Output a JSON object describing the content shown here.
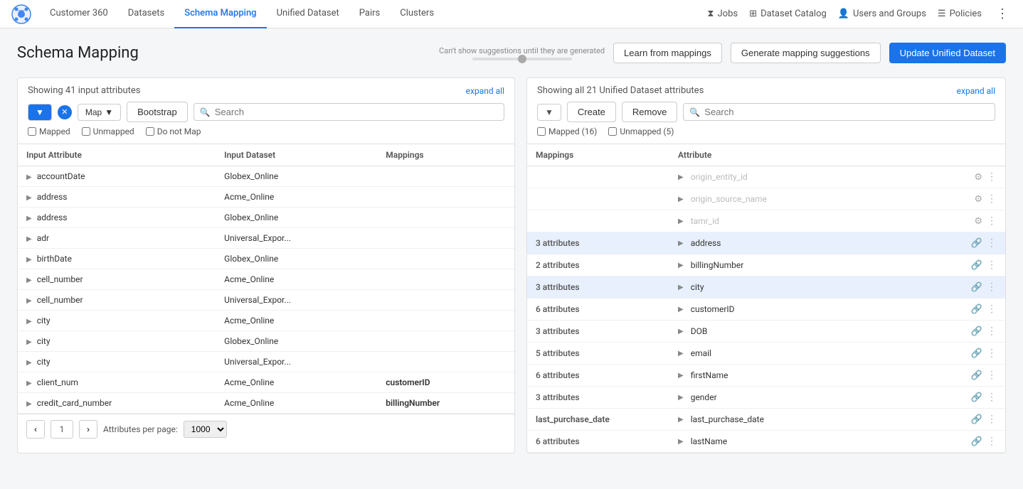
{
  "app": {
    "logo": "tamr-logo",
    "title": "Customer 360"
  },
  "nav": {
    "items": [
      {
        "id": "customer360",
        "label": "Customer 360",
        "active": false
      },
      {
        "id": "datasets",
        "label": "Datasets",
        "active": false
      },
      {
        "id": "schema-mapping",
        "label": "Schema Mapping",
        "active": true
      },
      {
        "id": "unified-dataset",
        "label": "Unified Dataset",
        "active": false
      },
      {
        "id": "pairs",
        "label": "Pairs",
        "active": false
      },
      {
        "id": "clusters",
        "label": "Clusters",
        "active": false
      }
    ],
    "right": [
      {
        "id": "jobs",
        "label": "Jobs",
        "icon": "⧗"
      },
      {
        "id": "dataset-catalog",
        "label": "Dataset Catalog",
        "icon": "⊞"
      },
      {
        "id": "users-groups",
        "label": "Users and Groups",
        "icon": "👤"
      },
      {
        "id": "policies",
        "label": "Policies",
        "icon": "⊟"
      }
    ],
    "more_icon": "⋮"
  },
  "page": {
    "title": "Schema Mapping",
    "suggestion_hint": "Can't show suggestions until they are generated",
    "btn_learn": "Learn from mappings",
    "btn_generate": "Generate mapping suggestions",
    "btn_update": "Update Unified Dataset"
  },
  "left_panel": {
    "title": "Showing 41 input attributes",
    "expand_all": "expand all",
    "filter_btn_label": "Map",
    "bootstrap_btn_label": "Bootstrap",
    "search_placeholder": "Search",
    "filter_mapped_label": "Mapped",
    "filter_unmapped_label": "Unmapped",
    "filter_donotmap_label": "Do not Map",
    "col_input_attr": "Input Attribute",
    "col_input_dataset": "Input Dataset",
    "col_mappings": "Mappings",
    "rows": [
      {
        "attr": "accountDate",
        "dataset": "Globex_Online",
        "mapping": ""
      },
      {
        "attr": "address",
        "dataset": "Acme_Online",
        "mapping": ""
      },
      {
        "attr": "address",
        "dataset": "Globex_Online",
        "mapping": ""
      },
      {
        "attr": "adr",
        "dataset": "Universal_Expor...",
        "mapping": ""
      },
      {
        "attr": "birthDate",
        "dataset": "Globex_Online",
        "mapping": ""
      },
      {
        "attr": "cell_number",
        "dataset": "Acme_Online",
        "mapping": ""
      },
      {
        "attr": "cell_number",
        "dataset": "Universal_Expor...",
        "mapping": ""
      },
      {
        "attr": "city",
        "dataset": "Acme_Online",
        "mapping": ""
      },
      {
        "attr": "city",
        "dataset": "Globex_Online",
        "mapping": ""
      },
      {
        "attr": "city",
        "dataset": "Universal_Expor...",
        "mapping": ""
      },
      {
        "attr": "client_num",
        "dataset": "Acme_Online",
        "mapping": "customerID"
      },
      {
        "attr": "credit_card_number",
        "dataset": "Acme_Online",
        "mapping": "billingNumber"
      }
    ],
    "pagination": {
      "current_page": 1,
      "per_page": "1000",
      "per_page_label": "Attributes per page:"
    }
  },
  "right_panel": {
    "title": "Showing all 21 Unified Dataset attributes",
    "expand_all": "expand all",
    "btn_create": "Create",
    "btn_remove": "Remove",
    "search_placeholder": "Search",
    "filter_mapped_label": "Mapped (16)",
    "filter_unmapped_label": "Unmapped (5)",
    "col_mappings": "Mappings",
    "col_attribute": "Attribute",
    "rows": [
      {
        "mappings": "",
        "attr": "origin_entity_id",
        "dimmed": true,
        "highlighted": false
      },
      {
        "mappings": "",
        "attr": "origin_source_name",
        "dimmed": true,
        "highlighted": false
      },
      {
        "mappings": "",
        "attr": "tamr_id",
        "dimmed": true,
        "highlighted": false
      },
      {
        "mappings": "3 attributes",
        "attr": "address",
        "dimmed": false,
        "highlighted": true
      },
      {
        "mappings": "2 attributes",
        "attr": "billingNumber",
        "dimmed": false,
        "highlighted": false
      },
      {
        "mappings": "3 attributes",
        "attr": "city",
        "dimmed": false,
        "highlighted": true
      },
      {
        "mappings": "6 attributes",
        "attr": "customerID",
        "dimmed": false,
        "highlighted": false
      },
      {
        "mappings": "3 attributes",
        "attr": "DOB",
        "dimmed": false,
        "highlighted": false
      },
      {
        "mappings": "5 attributes",
        "attr": "email",
        "dimmed": false,
        "highlighted": false
      },
      {
        "mappings": "6 attributes",
        "attr": "firstName",
        "dimmed": false,
        "highlighted": false
      },
      {
        "mappings": "3 attributes",
        "attr": "gender",
        "dimmed": false,
        "highlighted": false
      },
      {
        "mappings": "last_purchase_date",
        "attr": "last_purchase_date",
        "dimmed": false,
        "highlighted": false,
        "mappings_bold": true
      },
      {
        "mappings": "6 attributes",
        "attr": "lastName",
        "dimmed": false,
        "highlighted": false
      }
    ]
  }
}
